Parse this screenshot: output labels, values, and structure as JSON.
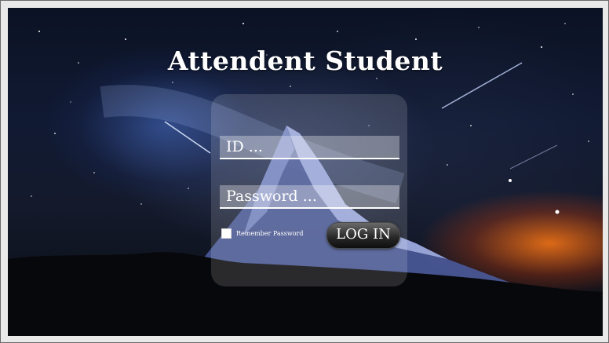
{
  "app": {
    "title": "Attendent Student"
  },
  "login": {
    "id_placeholder": "ID ...",
    "password_placeholder": "Password ...",
    "remember_label": "Remember Password",
    "remember_checked": false,
    "button_label": "LOG IN"
  },
  "colors": {
    "text": "#ffffff",
    "panel": "rgba(255,255,255,0.14)",
    "button": "#1a1a1a",
    "sky_glow": "#ff7a1a"
  }
}
